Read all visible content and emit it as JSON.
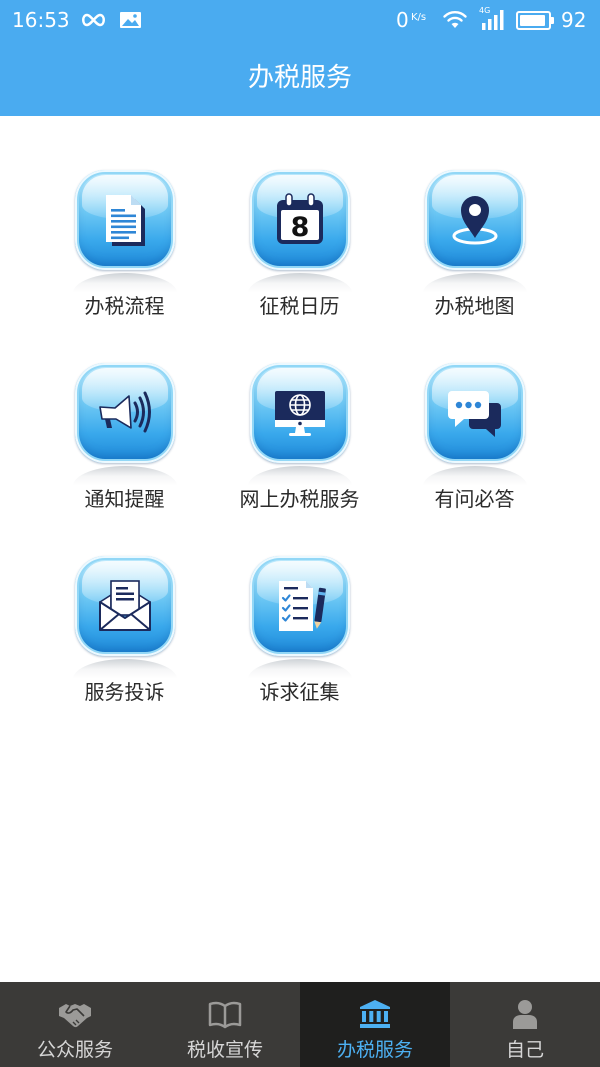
{
  "status_bar": {
    "time": "16:53",
    "net_speed": "0",
    "net_unit": "K/s",
    "network_type": "4G",
    "battery": "92",
    "icons": [
      "infinity-icon",
      "image-icon",
      "wifi-icon",
      "signal-icon",
      "battery-icon"
    ]
  },
  "header": {
    "title": "办税服务"
  },
  "services": [
    {
      "label": "办税流程",
      "icon": "document-icon"
    },
    {
      "label": "征税日历",
      "icon": "calendar-icon",
      "day": "8"
    },
    {
      "label": "办税地图",
      "icon": "map-pin-icon"
    },
    {
      "label": "通知提醒",
      "icon": "megaphone-icon"
    },
    {
      "label": "网上办税服务",
      "icon": "monitor-globe-icon"
    },
    {
      "label": "有问必答",
      "icon": "chat-bubbles-icon"
    },
    {
      "label": "服务投诉",
      "icon": "envelope-icon"
    },
    {
      "label": "诉求征集",
      "icon": "checklist-icon"
    }
  ],
  "bottom_nav": {
    "items": [
      {
        "label": "公众服务",
        "icon": "handshake-icon",
        "active": false
      },
      {
        "label": "税收宣传",
        "icon": "book-icon",
        "active": false
      },
      {
        "label": "办税服务",
        "icon": "bank-icon",
        "active": true
      },
      {
        "label": "自己",
        "icon": "person-icon",
        "active": false
      }
    ]
  },
  "colors": {
    "header_bg": "#4aabf0",
    "nav_bg": "#3b3a38",
    "nav_active_bg": "#1f1f1e",
    "nav_text": "#d6d6d6",
    "nav_active_text": "#4db0f2",
    "label": "#2b2b2b"
  }
}
